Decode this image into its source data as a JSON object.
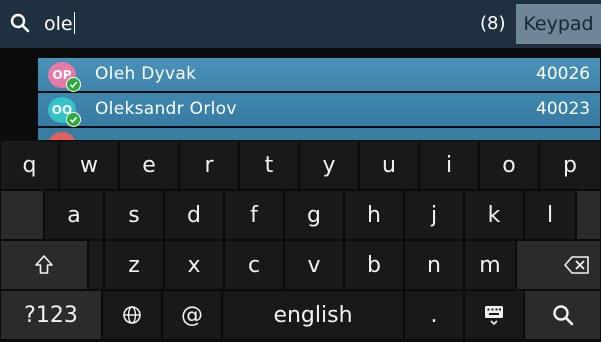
{
  "search": {
    "query": "ole",
    "count": "(8)",
    "keypad_label": "Keypad"
  },
  "results": [
    {
      "initials": "OP",
      "name": "Oleh Dyvak",
      "number": "40026",
      "avatar_color": "#e87aa7"
    },
    {
      "initials": "OO",
      "name": "Oleksandr Orlov",
      "number": "40023",
      "avatar_color": "#35c3c8"
    },
    {
      "initials": "",
      "name": "",
      "number": "",
      "avatar_color": "#e26060"
    }
  ],
  "keyboard": {
    "row1": [
      "q",
      "w",
      "e",
      "r",
      "t",
      "y",
      "u",
      "i",
      "o",
      "p"
    ],
    "row2": [
      "a",
      "s",
      "d",
      "f",
      "g",
      "h",
      "j",
      "k",
      "l"
    ],
    "row3": [
      "z",
      "x",
      "c",
      "v",
      "b",
      "n",
      "m"
    ],
    "symbols_key": "?123",
    "at_key": "@",
    "space_key": "english",
    "period_key": ".",
    "icons": {
      "shift": "shift-icon",
      "backspace": "backspace-icon",
      "globe": "globe-icon",
      "keyboard": "keyboard-icon",
      "search": "search-icon"
    }
  },
  "colors": {
    "search_bar": "#1f3140",
    "keypad_button": "#6e8696",
    "highlight_row": "#4a92b8",
    "keyboard_bg": "#0b0b0b",
    "key_bg": "#191919",
    "key_dark_bg": "#2b2b2b",
    "presence": "#2faa3c"
  }
}
